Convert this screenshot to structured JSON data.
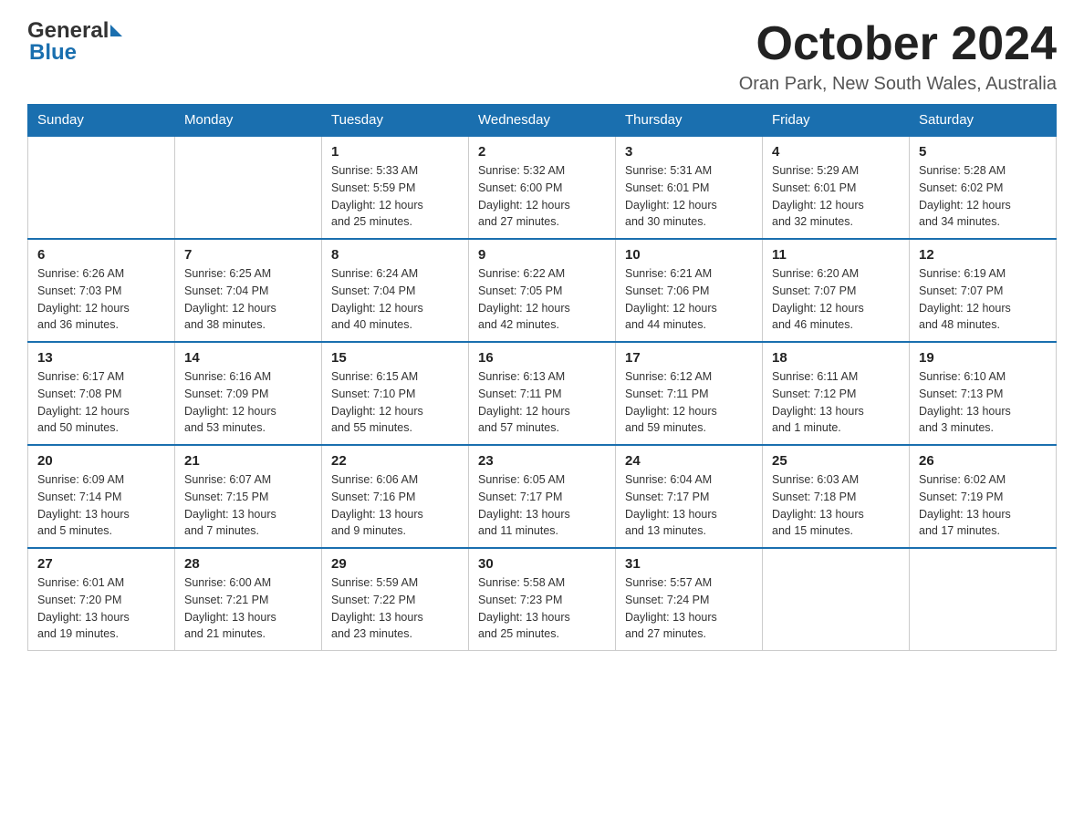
{
  "header": {
    "logo": {
      "general_text": "General",
      "blue_text": "Blue"
    },
    "title": "October 2024",
    "location": "Oran Park, New South Wales, Australia"
  },
  "days_of_week": [
    "Sunday",
    "Monday",
    "Tuesday",
    "Wednesday",
    "Thursday",
    "Friday",
    "Saturday"
  ],
  "weeks": [
    [
      {
        "day": "",
        "info": ""
      },
      {
        "day": "",
        "info": ""
      },
      {
        "day": "1",
        "info": "Sunrise: 5:33 AM\nSunset: 5:59 PM\nDaylight: 12 hours\nand 25 minutes."
      },
      {
        "day": "2",
        "info": "Sunrise: 5:32 AM\nSunset: 6:00 PM\nDaylight: 12 hours\nand 27 minutes."
      },
      {
        "day": "3",
        "info": "Sunrise: 5:31 AM\nSunset: 6:01 PM\nDaylight: 12 hours\nand 30 minutes."
      },
      {
        "day": "4",
        "info": "Sunrise: 5:29 AM\nSunset: 6:01 PM\nDaylight: 12 hours\nand 32 minutes."
      },
      {
        "day": "5",
        "info": "Sunrise: 5:28 AM\nSunset: 6:02 PM\nDaylight: 12 hours\nand 34 minutes."
      }
    ],
    [
      {
        "day": "6",
        "info": "Sunrise: 6:26 AM\nSunset: 7:03 PM\nDaylight: 12 hours\nand 36 minutes."
      },
      {
        "day": "7",
        "info": "Sunrise: 6:25 AM\nSunset: 7:04 PM\nDaylight: 12 hours\nand 38 minutes."
      },
      {
        "day": "8",
        "info": "Sunrise: 6:24 AM\nSunset: 7:04 PM\nDaylight: 12 hours\nand 40 minutes."
      },
      {
        "day": "9",
        "info": "Sunrise: 6:22 AM\nSunset: 7:05 PM\nDaylight: 12 hours\nand 42 minutes."
      },
      {
        "day": "10",
        "info": "Sunrise: 6:21 AM\nSunset: 7:06 PM\nDaylight: 12 hours\nand 44 minutes."
      },
      {
        "day": "11",
        "info": "Sunrise: 6:20 AM\nSunset: 7:07 PM\nDaylight: 12 hours\nand 46 minutes."
      },
      {
        "day": "12",
        "info": "Sunrise: 6:19 AM\nSunset: 7:07 PM\nDaylight: 12 hours\nand 48 minutes."
      }
    ],
    [
      {
        "day": "13",
        "info": "Sunrise: 6:17 AM\nSunset: 7:08 PM\nDaylight: 12 hours\nand 50 minutes."
      },
      {
        "day": "14",
        "info": "Sunrise: 6:16 AM\nSunset: 7:09 PM\nDaylight: 12 hours\nand 53 minutes."
      },
      {
        "day": "15",
        "info": "Sunrise: 6:15 AM\nSunset: 7:10 PM\nDaylight: 12 hours\nand 55 minutes."
      },
      {
        "day": "16",
        "info": "Sunrise: 6:13 AM\nSunset: 7:11 PM\nDaylight: 12 hours\nand 57 minutes."
      },
      {
        "day": "17",
        "info": "Sunrise: 6:12 AM\nSunset: 7:11 PM\nDaylight: 12 hours\nand 59 minutes."
      },
      {
        "day": "18",
        "info": "Sunrise: 6:11 AM\nSunset: 7:12 PM\nDaylight: 13 hours\nand 1 minute."
      },
      {
        "day": "19",
        "info": "Sunrise: 6:10 AM\nSunset: 7:13 PM\nDaylight: 13 hours\nand 3 minutes."
      }
    ],
    [
      {
        "day": "20",
        "info": "Sunrise: 6:09 AM\nSunset: 7:14 PM\nDaylight: 13 hours\nand 5 minutes."
      },
      {
        "day": "21",
        "info": "Sunrise: 6:07 AM\nSunset: 7:15 PM\nDaylight: 13 hours\nand 7 minutes."
      },
      {
        "day": "22",
        "info": "Sunrise: 6:06 AM\nSunset: 7:16 PM\nDaylight: 13 hours\nand 9 minutes."
      },
      {
        "day": "23",
        "info": "Sunrise: 6:05 AM\nSunset: 7:17 PM\nDaylight: 13 hours\nand 11 minutes."
      },
      {
        "day": "24",
        "info": "Sunrise: 6:04 AM\nSunset: 7:17 PM\nDaylight: 13 hours\nand 13 minutes."
      },
      {
        "day": "25",
        "info": "Sunrise: 6:03 AM\nSunset: 7:18 PM\nDaylight: 13 hours\nand 15 minutes."
      },
      {
        "day": "26",
        "info": "Sunrise: 6:02 AM\nSunset: 7:19 PM\nDaylight: 13 hours\nand 17 minutes."
      }
    ],
    [
      {
        "day": "27",
        "info": "Sunrise: 6:01 AM\nSunset: 7:20 PM\nDaylight: 13 hours\nand 19 minutes."
      },
      {
        "day": "28",
        "info": "Sunrise: 6:00 AM\nSunset: 7:21 PM\nDaylight: 13 hours\nand 21 minutes."
      },
      {
        "day": "29",
        "info": "Sunrise: 5:59 AM\nSunset: 7:22 PM\nDaylight: 13 hours\nand 23 minutes."
      },
      {
        "day": "30",
        "info": "Sunrise: 5:58 AM\nSunset: 7:23 PM\nDaylight: 13 hours\nand 25 minutes."
      },
      {
        "day": "31",
        "info": "Sunrise: 5:57 AM\nSunset: 7:24 PM\nDaylight: 13 hours\nand 27 minutes."
      },
      {
        "day": "",
        "info": ""
      },
      {
        "day": "",
        "info": ""
      }
    ]
  ]
}
